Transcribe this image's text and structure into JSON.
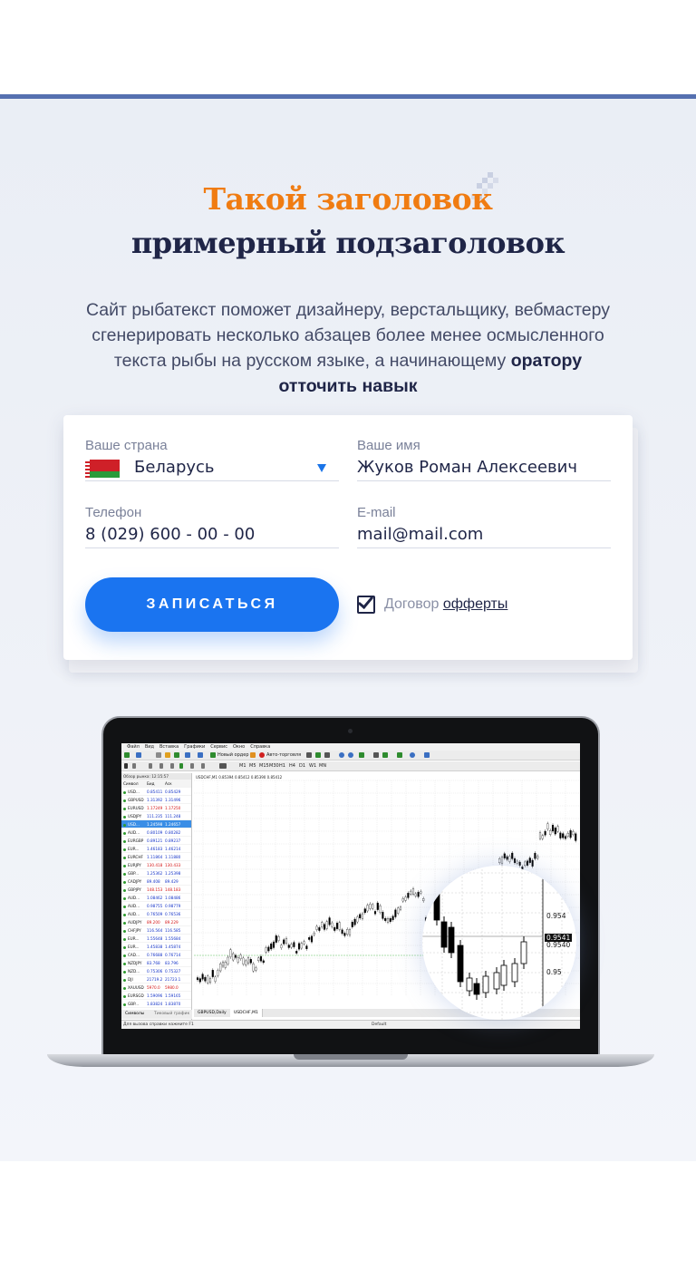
{
  "hero": {
    "title": "Такой заголовок",
    "subtitle": "примерный подзаголовок",
    "lead_text": "Сайт рыбатекст поможет дизайнеру, верстальщику, вебмастеру сгенерировать несколько абзацев более менее осмысленного текста рыбы на русском языке, а начинающему ",
    "lead_bold": "оратору отточить навык"
  },
  "form": {
    "country_label": "Ваше страна",
    "country_value": "Беларусь",
    "name_label": "Ваше имя",
    "name_value": "Жуков Роман Алексеевич",
    "phone_label": "Телефон",
    "phone_value": "8 (029) 600 - 00 - 00",
    "email_label": "E-mail",
    "email_value": "mail@mail.com",
    "submit_label": "ЗАПИСАТЬСЯ",
    "agreement_checked": true,
    "agreement_text": "Договор ",
    "agreement_link": "офферты"
  },
  "terminal": {
    "menu": [
      "Файл",
      "Вид",
      "Вставка",
      "Графики",
      "Сервис",
      "Окно",
      "Справка"
    ],
    "new_order": "Новый ордер",
    "autotrade": "Авто-торговля",
    "timeframes": [
      "M1",
      "M5",
      "M15",
      "M30",
      "H1",
      "H4",
      "D1",
      "W1",
      "MN"
    ],
    "market_watch_title": "Обзор рынка: 12:15:57",
    "columns": [
      "Символ",
      "Бид",
      "Аск"
    ],
    "rows": [
      {
        "s": "USD...",
        "b": "0.85411",
        "a": "0.85429"
      },
      {
        "s": "GBPUSD",
        "b": "1.31392",
        "a": "1.31496"
      },
      {
        "s": "EURUSD",
        "b": "1.17249",
        "a": "1.17250"
      },
      {
        "s": "USDJPY",
        "b": "111.235",
        "a": "111.248"
      },
      {
        "s": "USD...",
        "b": "1.24598",
        "a": "1.24657"
      },
      {
        "s": "AUD...",
        "b": "0.80109",
        "a": "0.80282"
      },
      {
        "s": "EURGBP",
        "b": "0.89121",
        "a": "0.89237"
      },
      {
        "s": "EUR...",
        "b": "1.46183",
        "a": "1.46214"
      },
      {
        "s": "EURCHF",
        "b": "1.11864",
        "a": "1.11880"
      },
      {
        "s": "EURJPY",
        "b": "130.418",
        "a": "130.433"
      },
      {
        "s": "GBP...",
        "b": "1.25362",
        "a": "1.25398"
      },
      {
        "s": "CADJPY",
        "b": "89.408",
        "a": "89.429"
      },
      {
        "s": "GBPJPY",
        "b": "148.153",
        "a": "148.183"
      },
      {
        "s": "AUD...",
        "b": "1.08462",
        "a": "1.08486"
      },
      {
        "s": "AUD...",
        "b": "0.98755",
        "a": "0.98779"
      },
      {
        "s": "AUD...",
        "b": "0.76509",
        "a": "0.76536"
      },
      {
        "s": "AUDJPY",
        "b": "89.200",
        "a": "89.229"
      },
      {
        "s": "CHFJPY",
        "b": "116.564",
        "a": "116.585"
      },
      {
        "s": "EUR...",
        "b": "1.55648",
        "a": "1.55684"
      },
      {
        "s": "EUR...",
        "b": "1.45838",
        "a": "1.45874"
      },
      {
        "s": "CAD...",
        "b": "0.76688",
        "a": "0.76714"
      },
      {
        "s": "NZDJPY",
        "b": "83.768",
        "a": "83.796"
      },
      {
        "s": "NZD...",
        "b": "0.75306",
        "a": "0.75327"
      },
      {
        "s": "DJI",
        "b": "21719.2",
        "a": "21723.1"
      },
      {
        "s": "XAUUSD",
        "b": "5970.0",
        "a": "5980.0"
      },
      {
        "s": "EURSGD",
        "b": "1.59096",
        "a": "1.59165"
      },
      {
        "s": "GBP...",
        "b": "1.83824",
        "a": "1.83870"
      }
    ],
    "window_tabs": [
      "Символы",
      "Тиковый график"
    ],
    "chart_tabs": [
      "GBPUSD,Daily",
      "USDCHF,M1"
    ],
    "chart_header": "USDCHF,M1  0.85394 0.85412 0.85390 0.85412",
    "status_help": "Для вызова справки нажмите F1",
    "status_default": "Default",
    "price_labels": [
      "0.954",
      "0.9541",
      "0.9540",
      "0.95"
    ]
  }
}
